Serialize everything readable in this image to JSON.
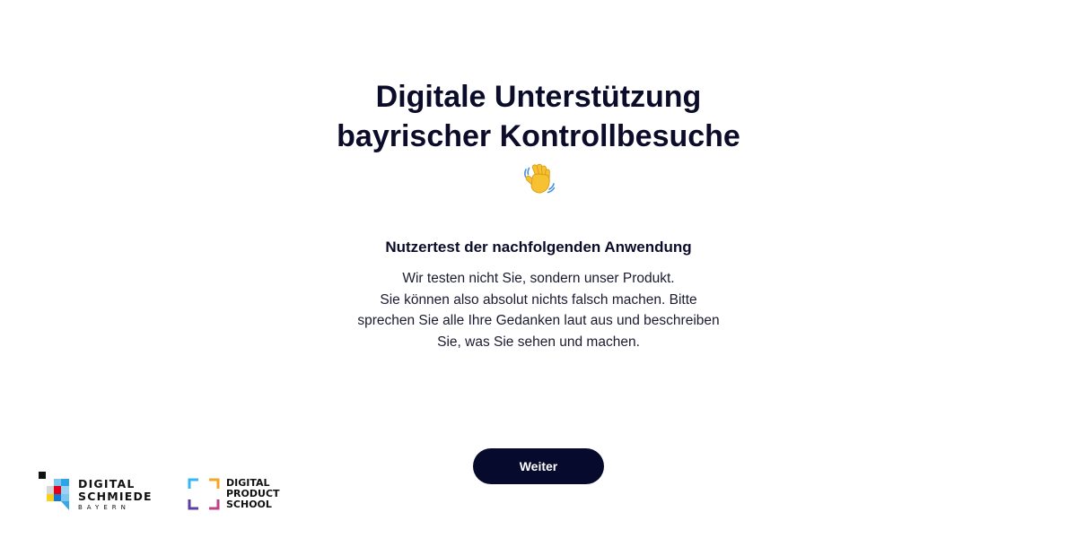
{
  "hero": {
    "title_line1": "Digitale Unterstützung",
    "title_line2": "bayrischer Kontrollbesuche",
    "emoji_icon": "waving-hand-icon"
  },
  "intro": {
    "heading": "Nutzertest der nachfolgenden Anwendung",
    "body_line1": "Wir testen nicht Sie, sondern unser Produkt.",
    "body_line2": "Sie können also absolut nichts falsch machen. Bitte",
    "body_line3": "sprechen Sie alle Ihre Gedanken laut aus und beschreiben",
    "body_line4": "Sie, was Sie sehen und machen."
  },
  "actions": {
    "continue_label": "Weiter"
  },
  "logos": {
    "digital_schmiede": {
      "line1": "DIGITAL",
      "line2": "SCHMIEDE",
      "line3": "BAYERN"
    },
    "digital_product_school": {
      "line1": "DIGITAL",
      "line2": "PRODUCT",
      "line3": "SCHOOL"
    }
  },
  "colors": {
    "text": "#0b0c2a",
    "button_bg": "#060a2c",
    "button_text": "#ffffff",
    "background": "#ffffff"
  }
}
